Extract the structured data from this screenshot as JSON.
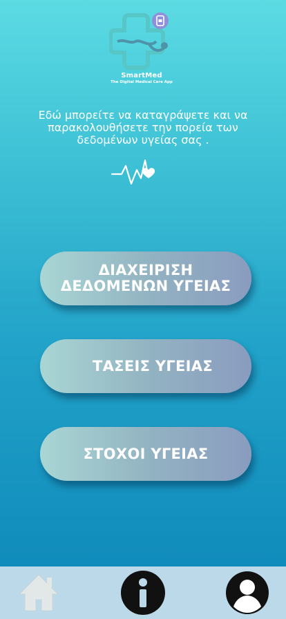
{
  "header": {
    "brand_name": "SmartMed",
    "brand_tagline": "The Digital Medical Care App"
  },
  "intro_text": "Εδώ μπορείτε να καταγράψετε και να παρακολουθήσετε την πορεία των δεδομένων υγείας σας .",
  "menu": {
    "manage_label": "ΔΙΑΧΕΙΡΙΣΗ ΔΕΔΟΜΕΝΩΝ ΥΓΕΙΑΣ",
    "trends_label": "ΤΑΣΕΙΣ ΥΓΕΙΑΣ",
    "goals_label": "ΣΤΟΧΟΙ ΥΓΕΙΑΣ"
  },
  "bottom_nav": {
    "items": [
      {
        "icon": "home-icon"
      },
      {
        "icon": "info-icon"
      },
      {
        "icon": "profile-icon"
      }
    ]
  },
  "colors": {
    "background_top": "#5cdbe3",
    "background_bottom": "#0c86b8",
    "button_gradient_start": "#a9d6d4",
    "button_gradient_end": "#8a9cbf",
    "nav_background": "#bcd9ea",
    "nav_icon_dark": "#111111",
    "nav_icon_home": "#e2e8e8"
  }
}
